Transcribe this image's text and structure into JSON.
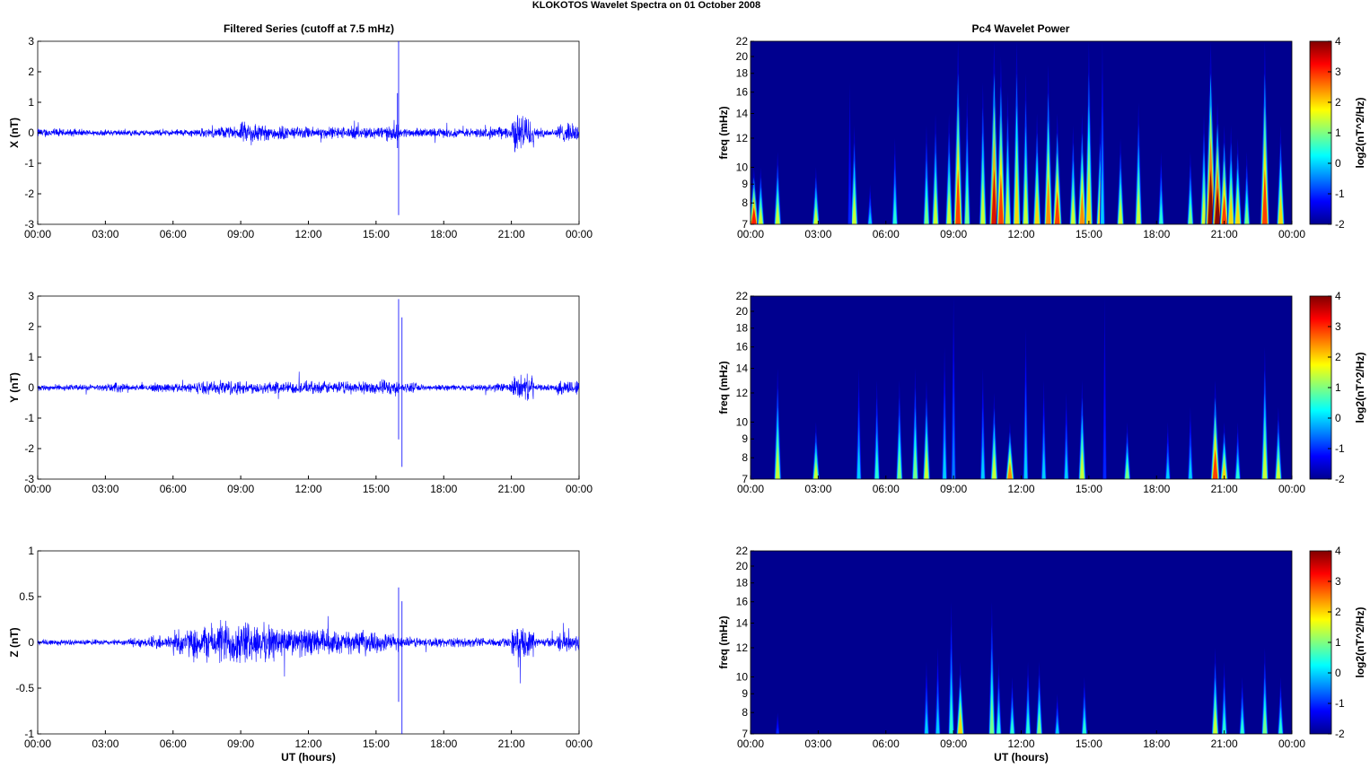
{
  "chart_data": {
    "title": "KLOKOTOS Wavelet Spectra on 01 October   2008",
    "left_title": "Filtered Series (cutoff at 7.5 mHz)",
    "right_title": "Pc4 Wavelet Power",
    "xlabel": "UT (hours)",
    "xticks": [
      "00:00",
      "03:00",
      "06:00",
      "09:00",
      "12:00",
      "15:00",
      "18:00",
      "21:00",
      "00:00"
    ],
    "xlim": [
      0,
      24
    ],
    "series": [
      {
        "type": "line",
        "name": "X",
        "ylabel": "X (nT)",
        "ylim": [
          -3,
          3
        ],
        "yticks": [
          "3",
          "2",
          "1",
          "0",
          "-1",
          "-2",
          "-3"
        ],
        "color": "#0000ff",
        "hourly_envelope_nT": [
          0.15,
          0.12,
          0.1,
          0.1,
          0.1,
          0.1,
          0.12,
          0.15,
          0.2,
          0.35,
          0.25,
          0.2,
          0.2,
          0.2,
          0.2,
          0.25,
          0.15,
          0.15,
          0.15,
          0.15,
          0.2,
          0.6,
          0.15,
          0.3
        ],
        "spikes": [
          {
            "hour": 16.0,
            "max": 3.0,
            "min": -2.7
          },
          {
            "hour": 15.95,
            "max": 1.3,
            "min": -0.5
          }
        ]
      },
      {
        "type": "line",
        "name": "Y",
        "ylabel": "Y (nT)",
        "ylim": [
          -3,
          3
        ],
        "yticks": [
          "3",
          "2",
          "1",
          "0",
          "-1",
          "-2",
          "-3"
        ],
        "color": "#0000ff",
        "hourly_envelope_nT": [
          0.1,
          0.1,
          0.1,
          0.15,
          0.1,
          0.15,
          0.15,
          0.2,
          0.25,
          0.2,
          0.2,
          0.2,
          0.2,
          0.2,
          0.2,
          0.25,
          0.15,
          0.1,
          0.1,
          0.1,
          0.15,
          0.4,
          0.1,
          0.25
        ],
        "spikes": [
          {
            "hour": 16.0,
            "max": 2.9,
            "min": -1.7
          },
          {
            "hour": 16.15,
            "max": 2.3,
            "min": -2.6
          }
        ]
      },
      {
        "type": "line",
        "name": "Z",
        "ylabel": "Z (nT)",
        "ylim": [
          -1,
          1
        ],
        "yticks": [
          "1",
          "0.5",
          "0",
          "-0.5",
          "-1"
        ],
        "color": "#0000ff",
        "hourly_envelope_nT": [
          0.04,
          0.03,
          0.03,
          0.03,
          0.05,
          0.08,
          0.15,
          0.2,
          0.25,
          0.22,
          0.2,
          0.15,
          0.15,
          0.12,
          0.12,
          0.1,
          0.06,
          0.05,
          0.05,
          0.05,
          0.05,
          0.15,
          0.05,
          0.1
        ],
        "spikes": [
          {
            "hour": 16.0,
            "max": 0.6,
            "min": -0.65
          },
          {
            "hour": 16.15,
            "max": 0.45,
            "min": -1.0
          }
        ]
      }
    ],
    "spectra": [
      {
        "type": "heatmap",
        "name": "X",
        "ylabel": "freq (mHz)",
        "ylim": [
          7,
          22
        ],
        "yscale": "log",
        "yticks": [
          "22",
          "20",
          "18",
          "16",
          "14",
          "12",
          "10",
          "9",
          "8",
          "7"
        ],
        "colorbar": {
          "label": "log2(nT^2/Hz)",
          "range": [
            -2,
            4
          ],
          "ticks": [
            "4",
            "3",
            "2",
            "1",
            "0",
            "-1",
            "-2"
          ]
        },
        "bursts_hour_topfreq_peak": [
          [
            0.15,
            10,
            3.2
          ],
          [
            0.45,
            10,
            1.5
          ],
          [
            1.2,
            11,
            1.5
          ],
          [
            2.9,
            10,
            1.5
          ],
          [
            4.6,
            13,
            1.5
          ],
          [
            4.4,
            17,
            -1
          ],
          [
            5.3,
            9,
            0
          ],
          [
            6.4,
            12,
            0.5
          ],
          [
            7.8,
            13,
            1
          ],
          [
            8.2,
            14,
            1.5
          ],
          [
            8.8,
            14,
            1.5
          ],
          [
            9.2,
            22,
            3
          ],
          [
            9.6,
            16,
            1
          ],
          [
            10.3,
            17,
            1.5
          ],
          [
            10.8,
            22,
            3.5
          ],
          [
            11.1,
            20,
            3
          ],
          [
            11.4,
            16,
            1.5
          ],
          [
            11.8,
            22,
            2
          ],
          [
            12.2,
            18,
            1.5
          ],
          [
            12.7,
            14,
            2
          ],
          [
            13.2,
            19,
            2.5
          ],
          [
            13.6,
            14,
            3
          ],
          [
            14.3,
            13,
            1.5
          ],
          [
            14.7,
            14,
            2.5
          ],
          [
            15.0,
            22,
            2
          ],
          [
            15.5,
            13,
            2
          ],
          [
            15.6,
            22,
            0
          ],
          [
            16.4,
            12,
            1.5
          ],
          [
            17.2,
            15,
            1.5
          ],
          [
            18.2,
            11,
            0.5
          ],
          [
            19.5,
            11,
            1
          ],
          [
            20.1,
            14,
            1.5
          ],
          [
            20.4,
            22,
            4
          ],
          [
            20.7,
            15,
            4
          ],
          [
            21.0,
            13,
            3
          ],
          [
            21.3,
            13,
            2
          ],
          [
            21.6,
            12,
            2
          ],
          [
            22.0,
            11,
            1
          ],
          [
            22.8,
            22,
            3
          ],
          [
            23.5,
            13,
            2
          ]
        ]
      },
      {
        "type": "heatmap",
        "name": "Y",
        "ylabel": "freq (mHz)",
        "ylim": [
          7,
          22
        ],
        "yscale": "log",
        "yticks": [
          "22",
          "20",
          "18",
          "16",
          "14",
          "12",
          "10",
          "9",
          "8",
          "7"
        ],
        "colorbar": {
          "label": "log2(nT^2/Hz)",
          "range": [
            -2,
            4
          ],
          "ticks": [
            "4",
            "3",
            "2",
            "1",
            "0",
            "-1",
            "-2"
          ]
        },
        "bursts_hour_topfreq_peak": [
          [
            1.2,
            14,
            1.5
          ],
          [
            2.9,
            10,
            1.5
          ],
          [
            4.8,
            14,
            0
          ],
          [
            5.6,
            13,
            0.5
          ],
          [
            6.6,
            13,
            1
          ],
          [
            7.3,
            14,
            1
          ],
          [
            7.8,
            13,
            1.5
          ],
          [
            8.6,
            16,
            0
          ],
          [
            9.0,
            22,
            -0.5
          ],
          [
            10.3,
            14,
            0
          ],
          [
            10.8,
            12,
            1.5
          ],
          [
            11.5,
            10,
            2.5
          ],
          [
            12.2,
            18,
            0
          ],
          [
            13.0,
            13,
            0
          ],
          [
            14.0,
            12,
            0
          ],
          [
            14.7,
            13,
            1.5
          ],
          [
            15.7,
            22,
            -1
          ],
          [
            16.7,
            10,
            1
          ],
          [
            18.5,
            10,
            0
          ],
          [
            19.5,
            11,
            0
          ],
          [
            20.6,
            13,
            3
          ],
          [
            21.0,
            10,
            2
          ],
          [
            21.6,
            10,
            0.5
          ],
          [
            22.8,
            16,
            1.5
          ],
          [
            23.4,
            11,
            1.5
          ]
        ]
      },
      {
        "type": "heatmap",
        "name": "Z",
        "ylabel": "freq (mHz)",
        "ylim": [
          7,
          22
        ],
        "yscale": "log",
        "yticks": [
          "22",
          "20",
          "18",
          "16",
          "14",
          "12",
          "10",
          "9",
          "8",
          "7"
        ],
        "colorbar": {
          "label": "log2(nT^2/Hz)",
          "range": [
            -2,
            4
          ],
          "ticks": [
            "4",
            "3",
            "2",
            "1",
            "0",
            "-1",
            "-2"
          ]
        },
        "bursts_hour_topfreq_peak": [
          [
            1.2,
            8,
            -1
          ],
          [
            7.8,
            11,
            0
          ],
          [
            8.3,
            12,
            0
          ],
          [
            8.9,
            16,
            0.5
          ],
          [
            9.3,
            11,
            2
          ],
          [
            10.7,
            16,
            1
          ],
          [
            11.0,
            11,
            0.5
          ],
          [
            11.6,
            10,
            0.5
          ],
          [
            12.3,
            11,
            0.5
          ],
          [
            12.8,
            11,
            1
          ],
          [
            13.6,
            9,
            0
          ],
          [
            14.8,
            10,
            0.5
          ],
          [
            20.6,
            12,
            1.5
          ],
          [
            21.0,
            11,
            0.5
          ],
          [
            21.8,
            10,
            0.5
          ],
          [
            22.8,
            12,
            1
          ],
          [
            23.5,
            10,
            0.5
          ]
        ]
      }
    ]
  }
}
